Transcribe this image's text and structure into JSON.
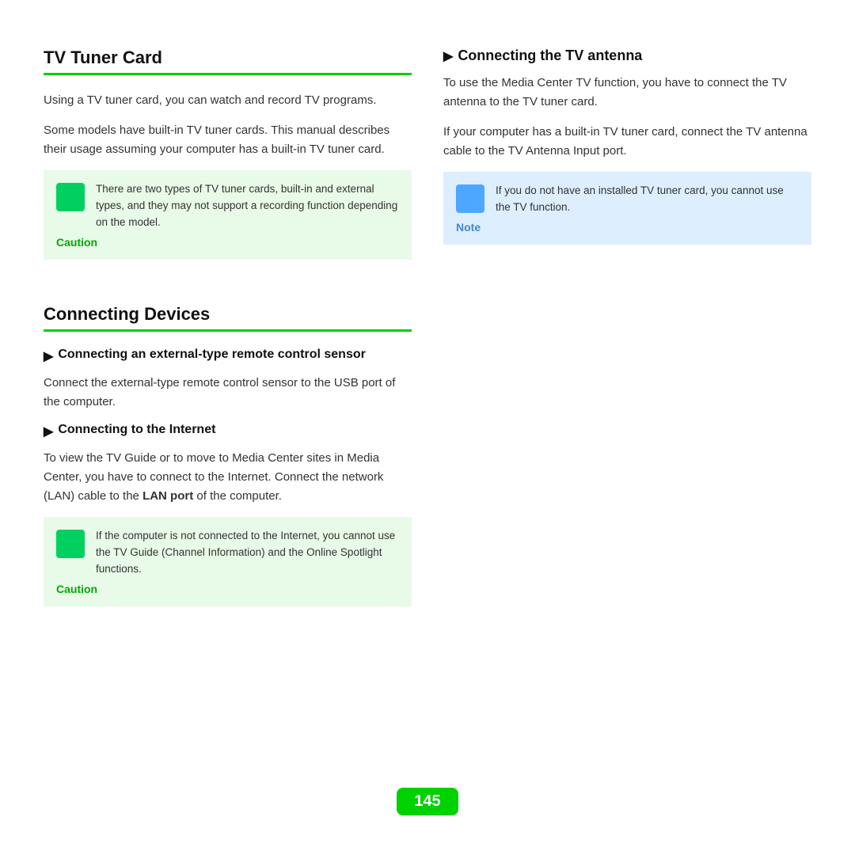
{
  "left": {
    "section1": {
      "title": "TV Tuner Card",
      "para1": "Using a TV tuner card, you can watch and record TV programs.",
      "para2": "Some models have built-in TV tuner cards. This manual describes their usage assuming your computer has a built-in TV tuner card.",
      "caution": {
        "label": "Caution",
        "text": "There are two types of TV tuner cards, built-in and external types, and they may not support a recording function depending on the model."
      }
    },
    "section2": {
      "title": "Connecting Devices",
      "sub1": {
        "title": "Connecting an external-type remote control sensor",
        "arrow": "▶",
        "para": "Connect the external-type remote control sensor to the USB port of the computer."
      },
      "sub2": {
        "title": "Connecting to the Internet",
        "arrow": "▶",
        "para1": "To view the TV Guide or to move to Media Center sites in Media Center, you have to connect to the Internet. Connect the network (LAN) cable to the ",
        "para1_bold": "LAN port",
        "para1_end": " of the computer.",
        "caution": {
          "label": "Caution",
          "text": "If the computer is not connected to the Internet, you cannot use the TV Guide (Channel Information) and the Online Spotlight functions."
        }
      }
    }
  },
  "right": {
    "sub1": {
      "title": "Connecting the TV antenna",
      "arrow": "▶",
      "para1": "To use the Media Center TV function, you have to connect the TV antenna to the TV tuner card.",
      "para2": "If your computer has a built-in TV tuner card, connect the TV antenna cable to the TV Antenna Input port.",
      "note": {
        "label": "Note",
        "text": "If you do not have an installed TV tuner card, you cannot use the TV function."
      }
    }
  },
  "footer": {
    "page_number": "145"
  }
}
